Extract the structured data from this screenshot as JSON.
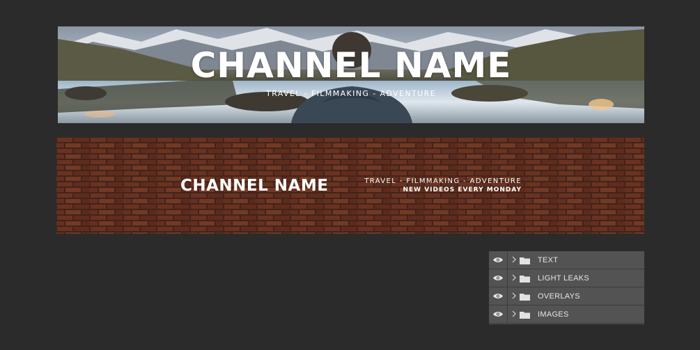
{
  "banner_top": {
    "title": "CHANNEL NAME",
    "tagline": "TRAVEL - FILMMAKING - ADVENTURE"
  },
  "banner_brick": {
    "title": "CHANNEL NAME",
    "tagline": "TRAVEL - FILMMAKING - ADVENTURE",
    "subline": "NEW VIDEOS EVERY MONDAY"
  },
  "layers_panel": {
    "layers": [
      {
        "name": "TEXT",
        "visible": true,
        "type": "folder",
        "expanded": false
      },
      {
        "name": "LIGHT LEAKS",
        "visible": true,
        "type": "folder",
        "expanded": false
      },
      {
        "name": "OVERLAYS",
        "visible": true,
        "type": "folder",
        "expanded": false
      },
      {
        "name": "IMAGES",
        "visible": true,
        "type": "folder",
        "expanded": false
      }
    ]
  },
  "colors": {
    "canvas_background": "#2b2b2b",
    "panel_background": "#535353",
    "panel_text": "#e6e6e6",
    "brick": "#6a3322"
  }
}
